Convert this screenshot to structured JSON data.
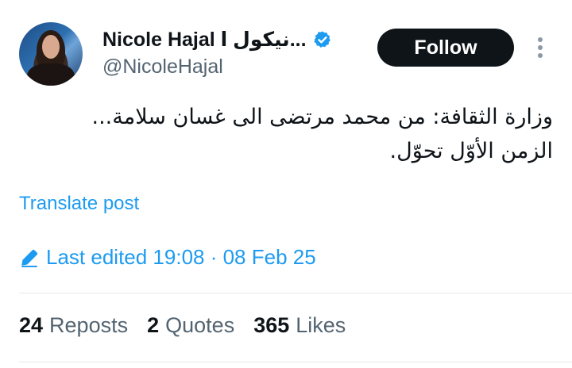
{
  "author": {
    "display_name": "Nicole Hajal نيكول ا...",
    "handle": "@NicoleHajal",
    "verified": true
  },
  "follow_label": "Follow",
  "post": {
    "lines": [
      "وزارة الثقافة: من  محمد مرتضى الى غسان سلامة...",
      "الزمن الأوّل تحوّل."
    ]
  },
  "translate_label": "Translate post",
  "last_edited": "Last edited 19:08 · 08 Feb 25",
  "stats": {
    "reposts": {
      "count": "24",
      "label": "Reposts"
    },
    "quotes": {
      "count": "2",
      "label": "Quotes"
    },
    "likes": {
      "count": "365",
      "label": "Likes"
    }
  },
  "colors": {
    "accent": "#1d9bf0",
    "text": "#0f1419",
    "secondary": "#536471",
    "button_bg": "#0f1419"
  }
}
